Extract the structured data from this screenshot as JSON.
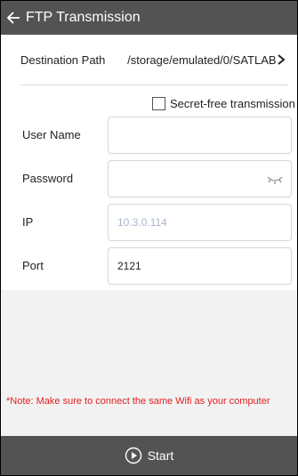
{
  "header": {
    "title": "FTP Transmission",
    "back_icon": "arrow-left-icon"
  },
  "destination": {
    "label": "Destination Path",
    "value": "/storage/emulated/0/SATLAB"
  },
  "secret_free": {
    "label": "Secret-free transmission",
    "checked": false
  },
  "fields": {
    "username": {
      "label": "User Name",
      "value": ""
    },
    "password": {
      "label": "Password",
      "value": ""
    },
    "ip": {
      "label": "IP",
      "placeholder": "10.3.0.114"
    },
    "port": {
      "label": "Port",
      "value": "2121"
    }
  },
  "note": "*Note: Make sure to connect the same Wifi as your computer",
  "footer": {
    "start_label": "Start",
    "play_icon": "play-circle-icon"
  },
  "colors": {
    "bar": "#535353",
    "note": "#e02020"
  }
}
